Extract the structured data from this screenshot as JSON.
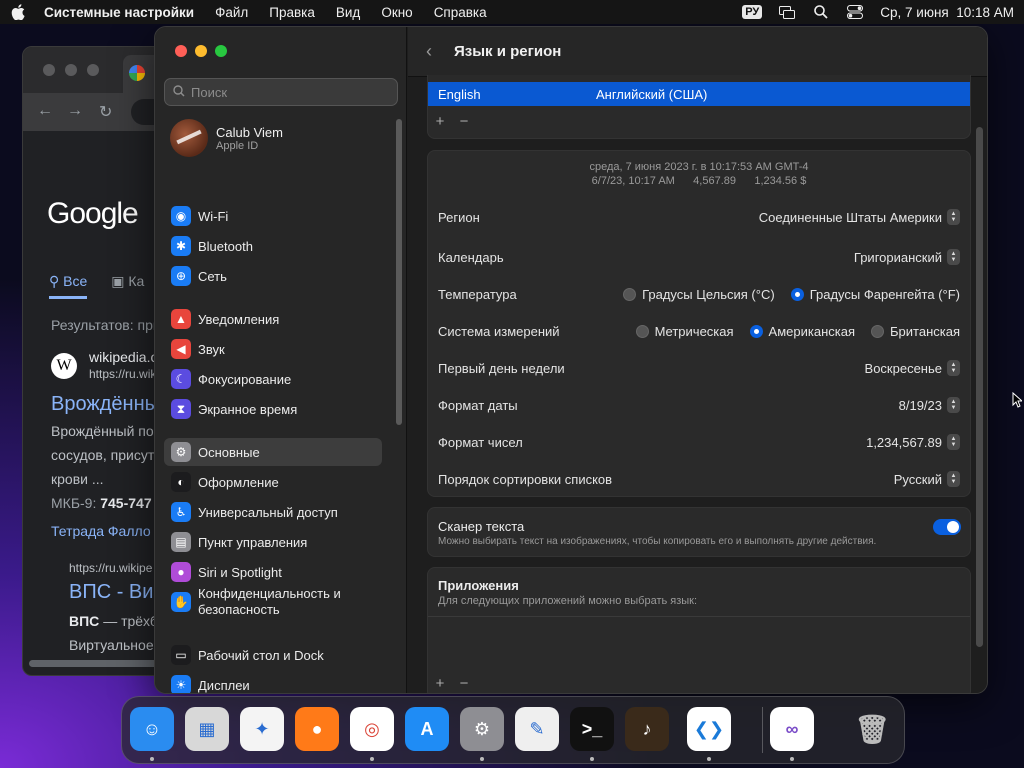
{
  "menubar": {
    "app_name": "Системные настройки",
    "menus": [
      "Файл",
      "Правка",
      "Вид",
      "Окно",
      "Справка"
    ],
    "input_source": "РУ",
    "datetime": "Ср, 7 июня  10:18 AM"
  },
  "browser": {
    "tab_icon": "google-g",
    "logo": "Google",
    "tab_all": "Все",
    "tab_images": "Ка",
    "results_count": "Результатов: при",
    "result1": {
      "site": "wikipedia.o",
      "url": "https://ru.wiki",
      "title": "Врождённы",
      "snippet": [
        "Врождённый по",
        "сосудов, присут",
        "крови ..."
      ],
      "icd_label": "МКБ-9:",
      "icd_value": "745-747",
      "sublink": "Тетрада Фалло"
    },
    "result2": {
      "url": "https://ru.wikipe",
      "title": "ВПС - Ви",
      "snippet_bold": "ВПС",
      "snippet": "— трёхб",
      "snippet2": "Виртуальное"
    }
  },
  "settings": {
    "search_placeholder": "Поиск",
    "profile": {
      "name": "Calub Viem",
      "sub": "Apple ID"
    },
    "sidebar": [
      {
        "label": "Wi-Fi",
        "icon": "wifi-icon",
        "color": "#1a7cf5",
        "glyph": "◉"
      },
      {
        "label": "Bluetooth",
        "icon": "bluetooth-icon",
        "color": "#1a7cf5",
        "glyph": "✱"
      },
      {
        "label": "Сеть",
        "icon": "network-icon",
        "color": "#1a7cf5",
        "glyph": "⊕"
      },
      {
        "label": "Уведомления",
        "icon": "bell-icon",
        "color": "#e8453c",
        "glyph": "▲"
      },
      {
        "label": "Звук",
        "icon": "speaker-icon",
        "color": "#e8453c",
        "glyph": "◀"
      },
      {
        "label": "Фокусирование",
        "icon": "moon-icon",
        "color": "#5b4ce0",
        "glyph": "☾"
      },
      {
        "label": "Экранное время",
        "icon": "hourglass-icon",
        "color": "#5b4ce0",
        "glyph": "⧗"
      },
      {
        "label": "Основные",
        "icon": "gear-icon",
        "color": "#8e8e93",
        "glyph": "⚙"
      },
      {
        "label": "Оформление",
        "icon": "appearance-icon",
        "color": "#1c1c1e",
        "glyph": "◐"
      },
      {
        "label": "Универсальный доступ",
        "icon": "accessibility-icon",
        "color": "#1a7cf5",
        "glyph": "♿"
      },
      {
        "label": "Пункт управления",
        "icon": "control-center-icon",
        "color": "#8e8e93",
        "glyph": "▤"
      },
      {
        "label": "Siri и Spotlight",
        "icon": "siri-icon",
        "color": "#b04cd8",
        "glyph": "●"
      },
      {
        "label": "Конфиденциальность и",
        "label2": "безопасность",
        "icon": "privacy-hand-icon",
        "color": "#1a7cf5",
        "glyph": "✋"
      },
      {
        "label": "Рабочий стол и Dock",
        "icon": "desktop-dock-icon",
        "color": "#1c1c1e",
        "glyph": "▭"
      },
      {
        "label": "Дисплеи",
        "icon": "display-icon",
        "color": "#1a7cf5",
        "glyph": "☀"
      },
      {
        "label": "Обои",
        "icon": "wallpaper-icon",
        "color": "#1aa3e0",
        "glyph": "✿"
      }
    ],
    "active_item": "Основные",
    "page_title": "Язык и регион",
    "language": {
      "name": "English",
      "native": "Английский (США)"
    },
    "preview_line1": "среда, 7 июня 2023 г. в 10:17:53 AM GMT-4",
    "preview_line2": "6/7/23, 10:17 AM      4,567.89      1,234.56 $",
    "rows": {
      "region": {
        "label": "Регион",
        "value": "Соединенные Штаты Америки"
      },
      "calendar": {
        "label": "Календарь",
        "value": "Григорианский"
      },
      "temperature": {
        "label": "Температура",
        "options": [
          "Градусы Цельсия (°C)",
          "Градусы Фаренгейта (°F)"
        ],
        "selected": 1
      },
      "measurement": {
        "label": "Система измерений",
        "options": [
          "Метрическая",
          "Американская",
          "Британская"
        ],
        "selected": 1
      },
      "first_day": {
        "label": "Первый день недели",
        "value": "Воскресенье"
      },
      "date_format": {
        "label": "Формат даты",
        "value": "8/19/23"
      },
      "number_format": {
        "label": "Формат чисел",
        "value": "1,234,567.89"
      },
      "sort_order": {
        "label": "Порядок сортировки списков",
        "value": "Русский"
      }
    },
    "scanner": {
      "title": "Сканер текста",
      "desc": "Можно выбирать текст на изображениях, чтобы копировать его и выполнять другие действия.",
      "enabled": true
    },
    "apps": {
      "title": "Приложения",
      "desc": "Для следующих приложений можно выбрать язык:"
    },
    "add_symbol": "+",
    "remove_symbol": "−"
  },
  "dock": [
    {
      "name": "finder",
      "icon": "finder-icon",
      "bg": "#2a8cf0",
      "glyph": "☺",
      "running": true
    },
    {
      "name": "launchpad",
      "icon": "launchpad-icon",
      "bg": "#d8d8d8",
      "glyph": "▦",
      "running": false
    },
    {
      "name": "safari",
      "icon": "safari-icon",
      "bg": "#f4f4f4",
      "glyph": "✦",
      "running": false
    },
    {
      "name": "firefox",
      "icon": "firefox-icon",
      "bg": "#ff7a18",
      "glyph": "●",
      "running": false
    },
    {
      "name": "chrome",
      "icon": "chrome-icon",
      "bg": "#ffffff",
      "glyph": "◎",
      "running": true
    },
    {
      "name": "app-store",
      "icon": "app-store-icon",
      "bg": "#1f8cf5",
      "glyph": "A",
      "running": false
    },
    {
      "name": "system-settings",
      "icon": "system-settings-icon",
      "bg": "#8e8e93",
      "glyph": "⚙",
      "running": true
    },
    {
      "name": "textedit",
      "icon": "textedit-icon",
      "bg": "#efefef",
      "glyph": "✎",
      "running": false
    },
    {
      "name": "terminal",
      "icon": "terminal-icon",
      "bg": "#111111",
      "glyph": ">_",
      "running": true
    },
    {
      "name": "garageband",
      "icon": "garageband-icon",
      "bg": "#3a2a1a",
      "glyph": "♪",
      "running": false
    },
    {
      "name": "vscode",
      "icon": "vscode-icon",
      "bg": "#ffffff",
      "glyph": "❮❯",
      "running": true
    },
    {
      "name": "visual-studio",
      "icon": "visual-studio-icon",
      "bg": "#ffffff",
      "glyph": "∞",
      "running": true
    },
    {
      "name": "trash",
      "icon": "trash-icon",
      "bg": "transparent",
      "glyph": "🗑",
      "running": false
    }
  ]
}
